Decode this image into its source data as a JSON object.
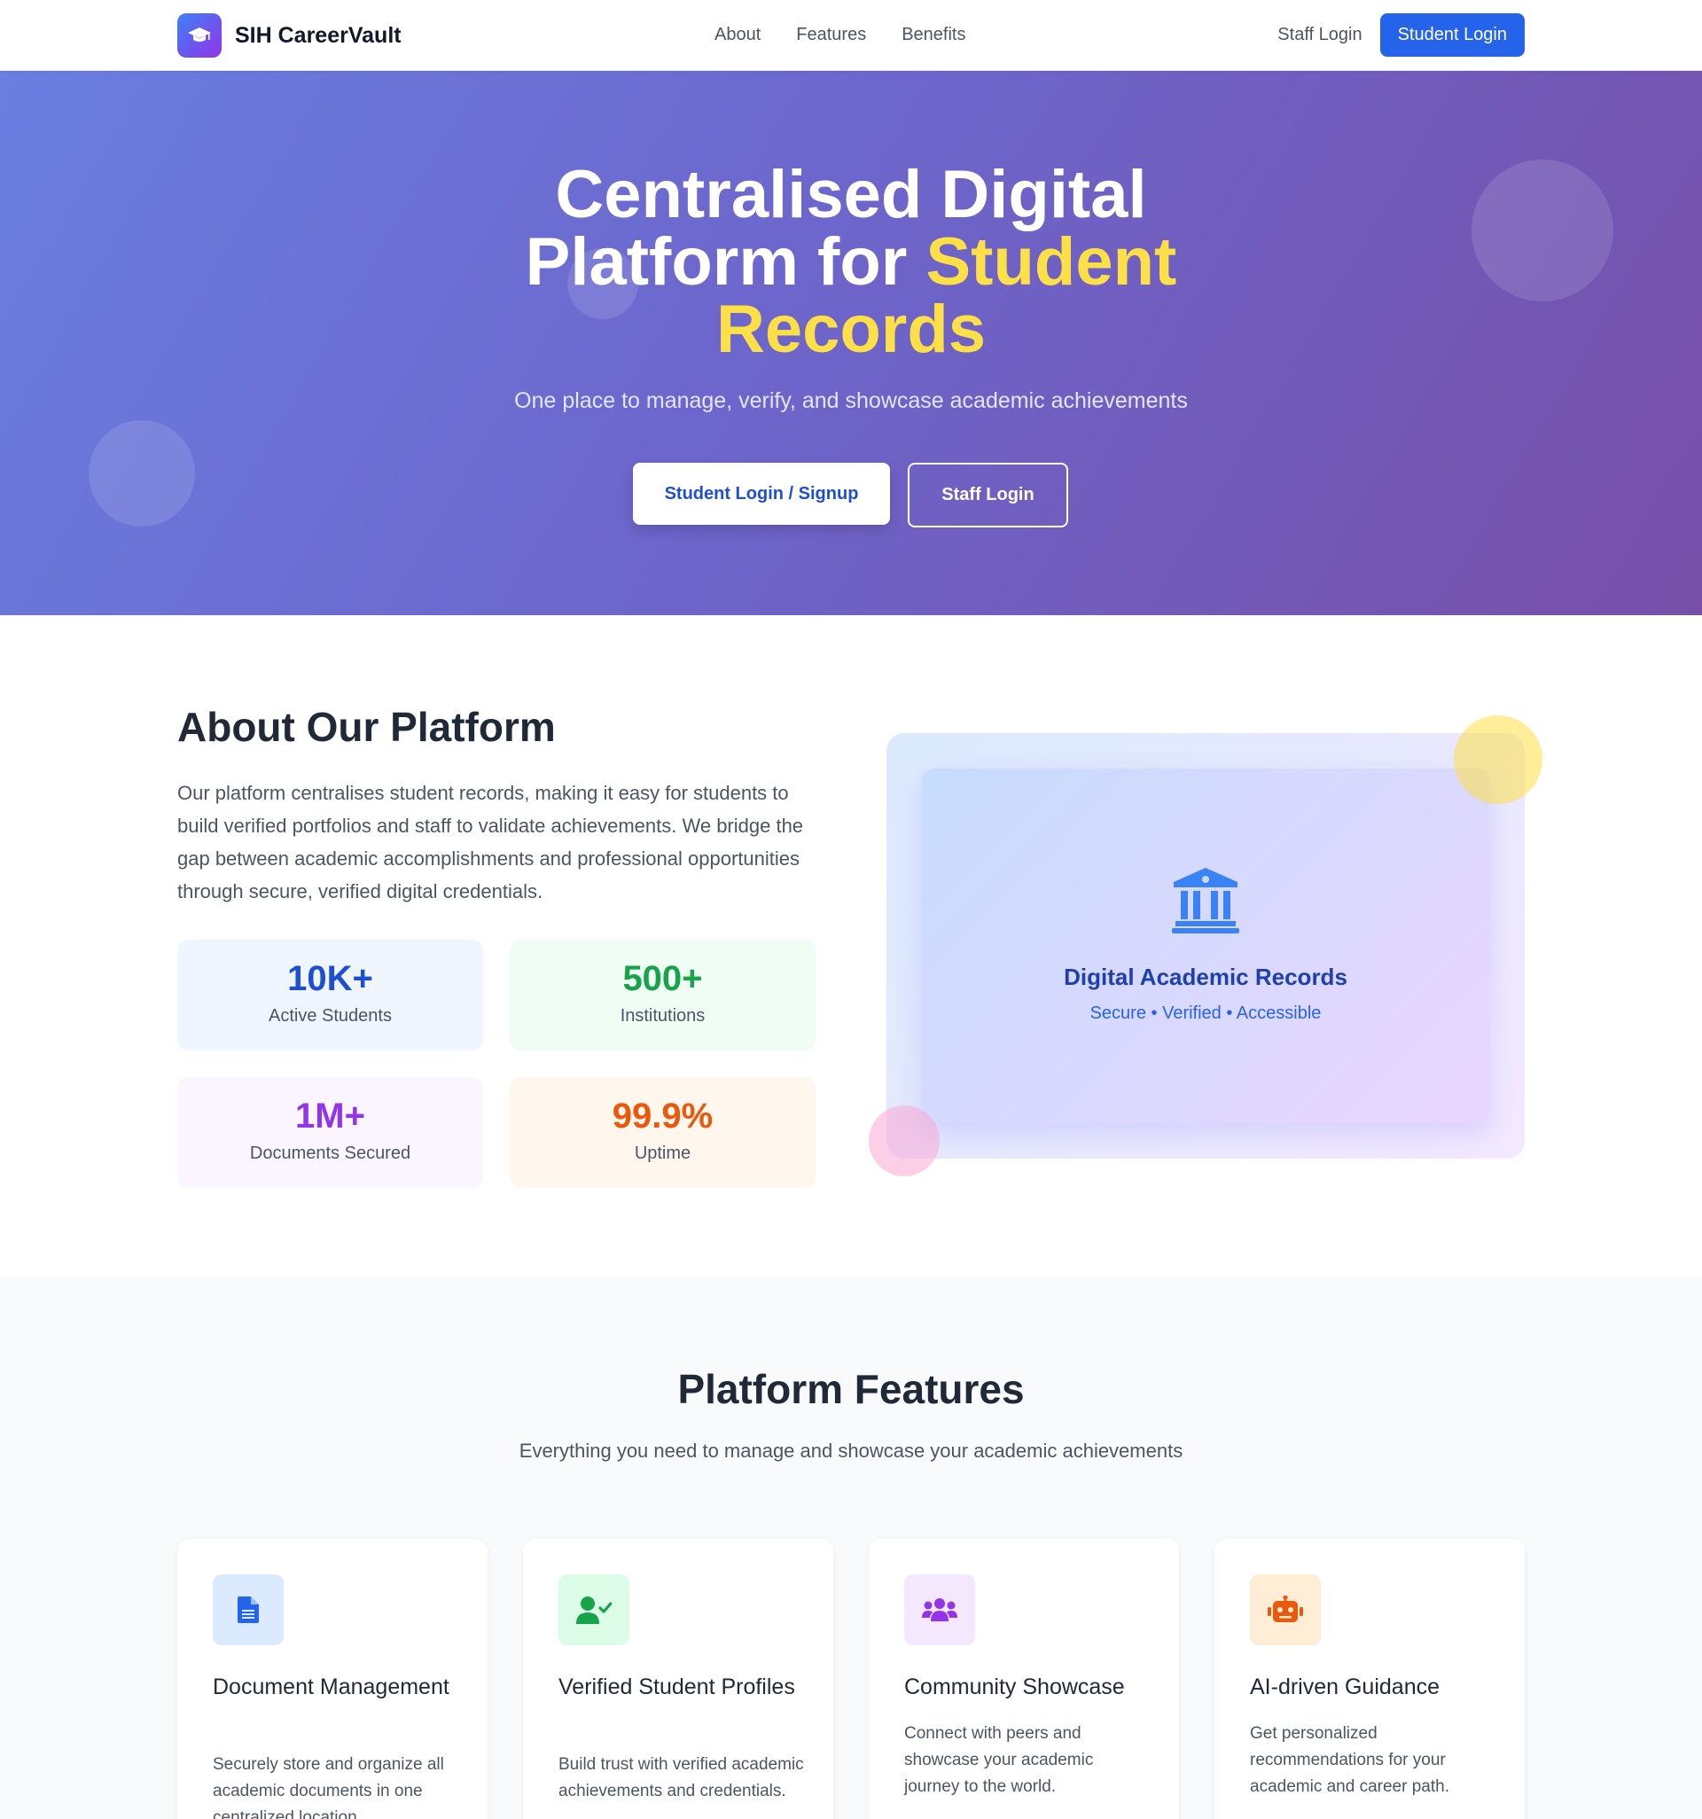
{
  "navbar": {
    "brand": "SIH CareerVault",
    "links": [
      "About",
      "Features",
      "Benefits"
    ],
    "staff_login": "Staff Login",
    "student_login": "Student Login"
  },
  "hero": {
    "title_line1": "Centralised Digital",
    "title_line2": "Platform for ",
    "title_highlight": "Student Records",
    "subtitle": "One place to manage, verify, and showcase academic achievements",
    "btn_primary": "Student Login / Signup",
    "btn_secondary": "Staff Login"
  },
  "about": {
    "title": "About Our Platform",
    "text": "Our platform centralises student records, making it easy for students to build verified portfolios and staff to validate achievements. We bridge the gap between academic accomplishments and professional opportunities through secure, verified digital credentials.",
    "stats": [
      {
        "value": "10K+",
        "label": "Active Students",
        "color": "#1d4ed8",
        "bg": "#eff6ff"
      },
      {
        "value": "500+",
        "label": "Institutions",
        "color": "#16a34a",
        "bg": "#f0fdf4"
      },
      {
        "value": "1M+",
        "label": "Documents Secured",
        "color": "#9333ea",
        "bg": "#faf5ff"
      },
      {
        "value": "99.9%",
        "label": "Uptime",
        "color": "#ea580c",
        "bg": "#fff7ed"
      }
    ],
    "visual": {
      "icon": "bank-building-icon",
      "title": "Digital Academic Records",
      "subtitle": "Secure • Verified • Accessible"
    }
  },
  "features": {
    "title": "Platform Features",
    "subtitle": "Everything you need to manage and showcase your academic achievements",
    "cards": [
      {
        "icon": "document-icon",
        "title": "Document Management",
        "desc": "Securely store and organize all academic documents in one centralized location.",
        "icon_bg": "#dbeafe",
        "icon_color": "#1d4ed8"
      },
      {
        "icon": "user-check-icon",
        "title": "Verified Student Profiles",
        "desc": "Build trust with verified academic achievements and credentials.",
        "icon_bg": "#dcfce7",
        "icon_color": "#16a34a"
      },
      {
        "icon": "users-icon",
        "title": "Community Showcase",
        "desc": "Connect with peers and showcase your academic journey to the world.",
        "icon_bg": "#f3e8ff",
        "icon_color": "#9333ea"
      },
      {
        "icon": "robot-icon",
        "title": "AI-driven Guidance",
        "desc": "Get personalized recommendations for your academic and career path.",
        "icon_bg": "#ffedd5",
        "icon_color": "#ea580c"
      }
    ]
  }
}
